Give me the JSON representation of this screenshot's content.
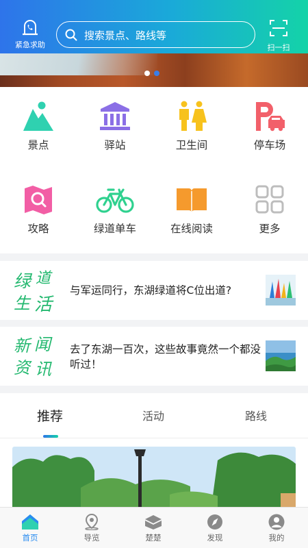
{
  "header": {
    "sos_label": "紧急求助",
    "search_placeholder": "搜索景点、路线等",
    "scan_label": "扫一扫"
  },
  "banner": {
    "page_count": 2,
    "active_index": 1
  },
  "grid": {
    "items": [
      {
        "label": "景点",
        "icon": "mountain-icon",
        "color": "#2fd1b0"
      },
      {
        "label": "驿站",
        "icon": "station-icon",
        "color": "#8b6fe6"
      },
      {
        "label": "卫生间",
        "icon": "restroom-icon",
        "color": "#f7c21d"
      },
      {
        "label": "停车场",
        "icon": "parking-icon",
        "color": "#f2606a"
      },
      {
        "label": "攻略",
        "icon": "guide-map-icon",
        "color": "#f25ea5"
      },
      {
        "label": "绿道单车",
        "icon": "bicycle-icon",
        "color": "#2fd18f"
      },
      {
        "label": "在线阅读",
        "icon": "book-icon",
        "color": "#f59a2d"
      },
      {
        "label": "更多",
        "icon": "more-grid-icon",
        "color": "#bdbdbd"
      }
    ]
  },
  "news": [
    {
      "logo_text": "绿道生活",
      "title": "与军运同行，东湖绿道将C位出道?"
    },
    {
      "logo_text": "新闻资讯",
      "title": "去了东湖一百次，这些故事竟然一个都没听过！"
    }
  ],
  "tabs": [
    {
      "label": "推荐",
      "active": true
    },
    {
      "label": "活动",
      "active": false
    },
    {
      "label": "路线",
      "active": false
    }
  ],
  "bottom_nav": [
    {
      "label": "首页",
      "icon": "home-icon",
      "active": true
    },
    {
      "label": "导览",
      "icon": "location-pin-icon",
      "active": false
    },
    {
      "label": "楚楚",
      "icon": "chuchu-icon",
      "active": false
    },
    {
      "label": "发现",
      "icon": "compass-icon",
      "active": false
    },
    {
      "label": "我的",
      "icon": "user-icon",
      "active": false
    }
  ],
  "colors": {
    "header_start": "#2e74ea",
    "header_end": "#14d3a8",
    "active_nav": "#2a8cf0"
  }
}
